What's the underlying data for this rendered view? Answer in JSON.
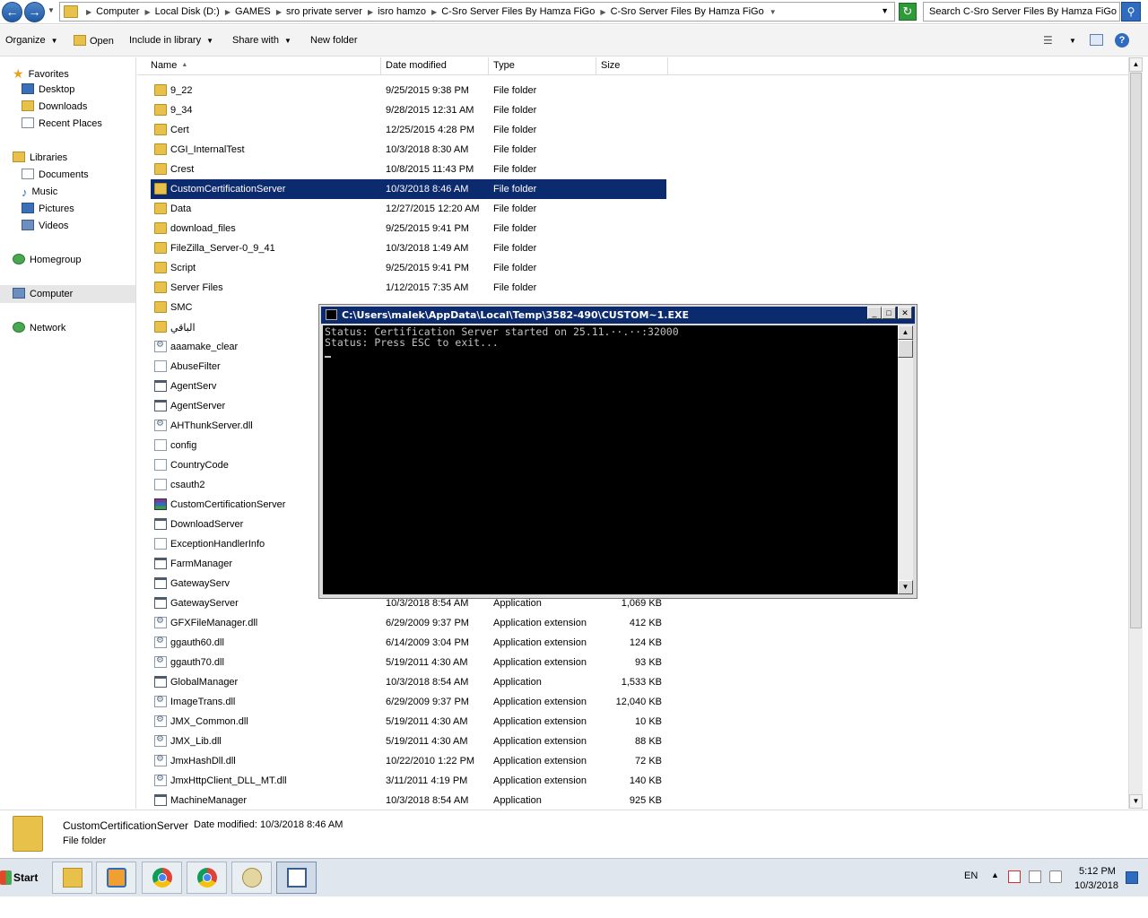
{
  "address": {
    "crumbs": [
      "Computer",
      "Local Disk (D:)",
      "GAMES",
      "sro private server",
      "isro hamzo",
      "C-Sro Server Files By Hamza FiGo",
      "C-Sro Server Files By Hamza FiGo"
    ],
    "search_placeholder": "Search C-Sro Server Files By Hamza FiGo"
  },
  "toolbar": {
    "organize": "Organize",
    "open": "Open",
    "include": "Include in library",
    "share": "Share with",
    "newfolder": "New folder"
  },
  "nav": {
    "favorites": "Favorites",
    "desktop": "Desktop",
    "downloads": "Downloads",
    "recent": "Recent Places",
    "libraries": "Libraries",
    "documents": "Documents",
    "music": "Music",
    "pictures": "Pictures",
    "videos": "Videos",
    "homegroup": "Homegroup",
    "computer": "Computer",
    "network": "Network"
  },
  "columns": {
    "name": "Name",
    "date": "Date modified",
    "type": "Type",
    "size": "Size"
  },
  "files": [
    {
      "name": "9_22",
      "date": "9/25/2015 9:38 PM",
      "type": "File folder",
      "size": "",
      "icon": "folder"
    },
    {
      "name": "9_34",
      "date": "9/28/2015 12:31 AM",
      "type": "File folder",
      "size": "",
      "icon": "folder"
    },
    {
      "name": "Cert",
      "date": "12/25/2015 4:28 PM",
      "type": "File folder",
      "size": "",
      "icon": "folder"
    },
    {
      "name": "CGI_InternalTest",
      "date": "10/3/2018 8:30 AM",
      "type": "File folder",
      "size": "",
      "icon": "folder"
    },
    {
      "name": "Crest",
      "date": "10/8/2015 11:43 PM",
      "type": "File folder",
      "size": "",
      "icon": "folder"
    },
    {
      "name": "CustomCertificationServer",
      "date": "10/3/2018 8:46 AM",
      "type": "File folder",
      "size": "",
      "icon": "folder",
      "selected": true
    },
    {
      "name": "Data",
      "date": "12/27/2015 12:20 AM",
      "type": "File folder",
      "size": "",
      "icon": "folder"
    },
    {
      "name": "download_files",
      "date": "9/25/2015 9:41 PM",
      "type": "File folder",
      "size": "",
      "icon": "folder"
    },
    {
      "name": "FileZilla_Server-0_9_41",
      "date": "10/3/2018 1:49 AM",
      "type": "File folder",
      "size": "",
      "icon": "folder"
    },
    {
      "name": "Script",
      "date": "9/25/2015 9:41 PM",
      "type": "File folder",
      "size": "",
      "icon": "folder"
    },
    {
      "name": "Server Files",
      "date": "1/12/2015 7:35 AM",
      "type": "File folder",
      "size": "",
      "icon": "folder"
    },
    {
      "name": "SMC",
      "date": "",
      "type": "",
      "size": "",
      "icon": "folder"
    },
    {
      "name": "الباقي",
      "date": "",
      "type": "",
      "size": "",
      "icon": "folder"
    },
    {
      "name": "aaamake_clear",
      "date": "",
      "type": "",
      "size": "",
      "icon": "dll"
    },
    {
      "name": "AbuseFilter",
      "date": "",
      "type": "",
      "size": "",
      "icon": "file"
    },
    {
      "name": "AgentServ",
      "date": "",
      "type": "",
      "size": "",
      "icon": "app"
    },
    {
      "name": "AgentServer",
      "date": "",
      "type": "",
      "size": "",
      "icon": "app"
    },
    {
      "name": "AHThunkServer.dll",
      "date": "",
      "type": "",
      "size": "",
      "icon": "dll"
    },
    {
      "name": "config",
      "date": "",
      "type": "",
      "size": "",
      "icon": "file"
    },
    {
      "name": "CountryCode",
      "date": "",
      "type": "",
      "size": "",
      "icon": "file"
    },
    {
      "name": "csauth2",
      "date": "",
      "type": "",
      "size": "",
      "icon": "file"
    },
    {
      "name": "CustomCertificationServer",
      "date": "",
      "type": "",
      "size": "",
      "icon": "rar"
    },
    {
      "name": "DownloadServer",
      "date": "",
      "type": "",
      "size": "",
      "icon": "app"
    },
    {
      "name": "ExceptionHandlerInfo",
      "date": "",
      "type": "",
      "size": "",
      "icon": "file"
    },
    {
      "name": "FarmManager",
      "date": "",
      "type": "",
      "size": "",
      "icon": "app"
    },
    {
      "name": "GatewayServ",
      "date": "",
      "type": "",
      "size": "",
      "icon": "app"
    },
    {
      "name": "GatewayServer",
      "date": "10/3/2018 8:54 AM",
      "type": "Application",
      "size": "1,069 KB",
      "icon": "app"
    },
    {
      "name": "GFXFileManager.dll",
      "date": "6/29/2009 9:37 PM",
      "type": "Application extension",
      "size": "412 KB",
      "icon": "dll"
    },
    {
      "name": "ggauth60.dll",
      "date": "6/14/2009 3:04 PM",
      "type": "Application extension",
      "size": "124 KB",
      "icon": "dll"
    },
    {
      "name": "ggauth70.dll",
      "date": "5/19/2011 4:30 AM",
      "type": "Application extension",
      "size": "93 KB",
      "icon": "dll"
    },
    {
      "name": "GlobalManager",
      "date": "10/3/2018 8:54 AM",
      "type": "Application",
      "size": "1,533 KB",
      "icon": "app"
    },
    {
      "name": "ImageTrans.dll",
      "date": "6/29/2009 9:37 PM",
      "type": "Application extension",
      "size": "12,040 KB",
      "icon": "dll"
    },
    {
      "name": "JMX_Common.dll",
      "date": "5/19/2011 4:30 AM",
      "type": "Application extension",
      "size": "10 KB",
      "icon": "dll"
    },
    {
      "name": "JMX_Lib.dll",
      "date": "5/19/2011 4:30 AM",
      "type": "Application extension",
      "size": "88 KB",
      "icon": "dll"
    },
    {
      "name": "JmxHashDll.dll",
      "date": "10/22/2010 1:22 PM",
      "type": "Application extension",
      "size": "72 KB",
      "icon": "dll"
    },
    {
      "name": "JmxHttpClient_DLL_MT.dll",
      "date": "3/11/2011 4:19 PM",
      "type": "Application extension",
      "size": "140 KB",
      "icon": "dll"
    },
    {
      "name": "MachineManager",
      "date": "10/3/2018 8:54 AM",
      "type": "Application",
      "size": "925 KB",
      "icon": "app"
    }
  ],
  "details": {
    "name": "CustomCertificationServer",
    "date_label": "Date modified:",
    "date_value": "10/3/2018 8:46 AM",
    "type": "File folder"
  },
  "console": {
    "title": "C:\\Users\\malek\\AppData\\Local\\Temp\\3582-490\\CUSTOM~1.EXE",
    "lines": [
      "Status: Certification Server started on 25.11.··.··:32000",
      "Status: Press ESC to exit..."
    ]
  },
  "taskbar": {
    "start": "Start",
    "lang": "EN",
    "time": "5:12 PM",
    "date": "10/3/2018"
  }
}
